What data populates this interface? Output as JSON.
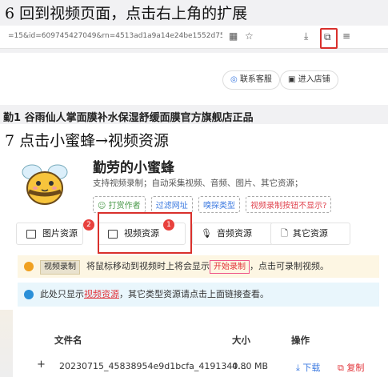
{
  "step6": {
    "title": "6 回到视频页面，点击右上角的扩展"
  },
  "browser": {
    "url": "=15&id=609745427049&rn=4513ad1a9a14e24be1552d758",
    "icons": [
      "grid-icon",
      "star-icon",
      "download-icon",
      "extensions-icon",
      "menu-icon"
    ]
  },
  "shop": {
    "contact_label": "联系客服",
    "enter_label": "进入店铺",
    "partial_title": "勤1 谷雨仙人掌面膜补水保湿舒缓面膜官方旗舰店正品"
  },
  "step7": {
    "title": "7 点击小蜜蜂→视频资源"
  },
  "app": {
    "name": "勤劳的小蜜蜂",
    "description": "支持视频录制；自动采集视频、音频、图片、其它资源；",
    "tags": [
      "打赏作者",
      "过滤网址",
      "嗅探类型",
      "视频录制按钮不显示?"
    ]
  },
  "tabs": [
    {
      "label": "图片资源",
      "badge": "2"
    },
    {
      "label": "视频资源",
      "badge": "1"
    },
    {
      "label": "音频资源"
    },
    {
      "label": "其它资源"
    }
  ],
  "notice1": {
    "tag": "视频录制",
    "text_before": "将鼠标移动到视频时上将会显示",
    "button": "开始录制",
    "text_after": "，点击可录制视频。"
  },
  "notice2": {
    "text_before": "此处只显示",
    "highlight": "视频资源",
    "text_after": "，其它类型资源请点击上面链接查看。"
  },
  "table": {
    "headers": [
      "文件名",
      "大小",
      "操作"
    ],
    "rows": [
      {
        "expand": "+",
        "filename": "20230715_45838954e9d1bcfa_4191340...",
        "size": "4.80 MB",
        "download": "下载",
        "copy": "复制"
      }
    ]
  },
  "colors": {
    "highlight": "#d9302c",
    "link": "#3c7ae0",
    "badge": "#e8413d"
  }
}
